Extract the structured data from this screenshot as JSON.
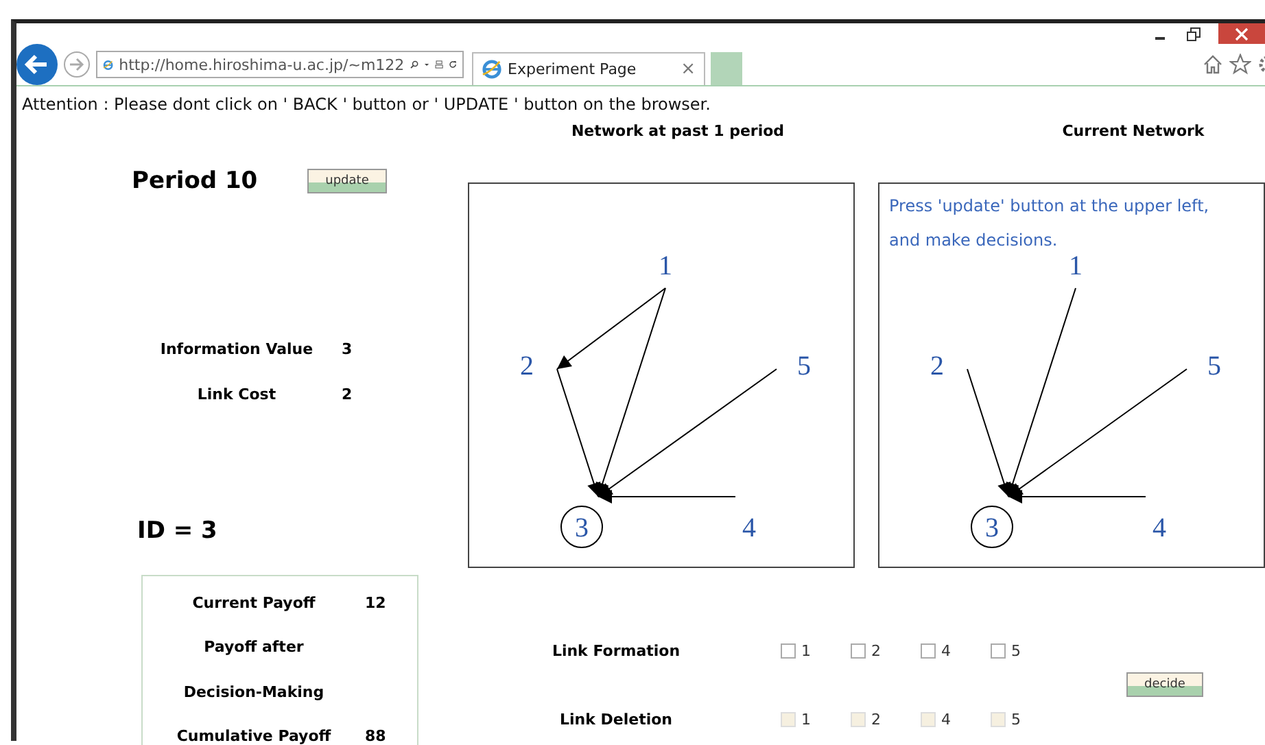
{
  "browser": {
    "address": "http://home.hiroshima-u.ac.jp/~m122",
    "tab": {
      "title": "Experiment Page",
      "close": "×"
    }
  },
  "notice": "Attention : Please dont click on ' BACK ' button or ' UPDATE ' button on the browser.",
  "period": "Period 10",
  "update_button": "update",
  "parameters": [
    {
      "label": "Information Value",
      "value": "3"
    },
    {
      "label": "Link Cost",
      "value": "2"
    }
  ],
  "id": "ID = 3",
  "payoff": [
    {
      "label": "Current Payoff",
      "value": "12"
    },
    {
      "label": "Payoff after"
    },
    {
      "label": "Decision-Making"
    },
    {
      "label": "Cumulative Payoff",
      "value": "88"
    }
  ],
  "networks": [
    {
      "title": "Network at past 1 period",
      "nodes": [
        {
          "label": "1",
          "self": false
        },
        {
          "label": "2",
          "self": false
        },
        {
          "label": "3",
          "self": true
        },
        {
          "label": "4",
          "self": false
        },
        {
          "label": "5",
          "self": false
        }
      ],
      "edges": [
        {
          "kind": "top_left"
        },
        {
          "kind": "top_self"
        },
        {
          "kind": "left_self"
        },
        {
          "kind": "right_self"
        },
        {
          "kind": "bottom_self"
        }
      ]
    },
    {
      "title": "Current Network",
      "message": "Press 'update' button at the upper left, and make decisions.",
      "nodes": [
        {
          "label": "1",
          "self": false
        },
        {
          "label": "2",
          "self": false
        },
        {
          "label": "3",
          "self": true
        },
        {
          "label": "4",
          "self": false
        },
        {
          "label": "5",
          "self": false
        }
      ],
      "edges": [
        {
          "kind": "top_self"
        },
        {
          "kind": "left_self"
        },
        {
          "kind": "right_self"
        },
        {
          "kind": "bottom_self"
        }
      ]
    }
  ],
  "decisions": [
    {
      "label": "Link Formation",
      "options": [
        {
          "label": "1",
          "checked": false,
          "disabled": false
        },
        {
          "label": "2",
          "checked": false,
          "disabled": false
        },
        {
          "label": "4",
          "checked": false,
          "disabled": false
        },
        {
          "label": "5",
          "checked": false,
          "disabled": false
        }
      ]
    },
    {
      "label": "Link Deletion",
      "options": [
        {
          "label": "1",
          "checked": false,
          "disabled": true
        },
        {
          "label": "2",
          "checked": false,
          "disabled": true
        },
        {
          "label": "4",
          "checked": false,
          "disabled": true
        },
        {
          "label": "5",
          "checked": false,
          "disabled": true
        }
      ]
    }
  ],
  "decide_button": "decide"
}
